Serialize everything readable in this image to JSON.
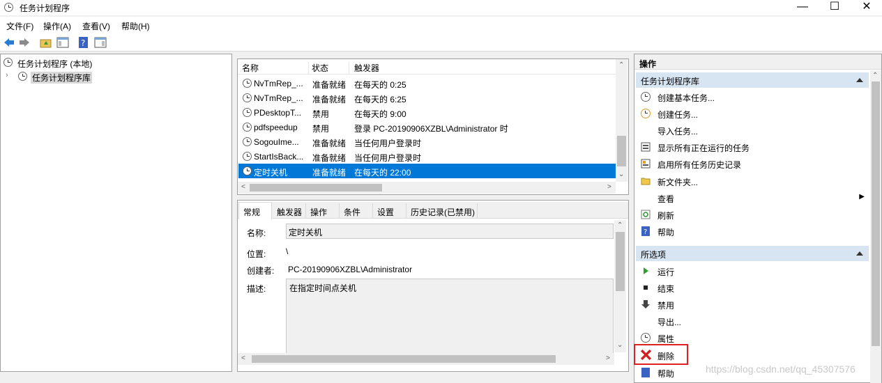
{
  "window": {
    "title": "任务计划程序"
  },
  "menu": [
    "文件(F)",
    "操作(A)",
    "查看(V)",
    "帮助(H)"
  ],
  "tree": {
    "root": "任务计划程序 (本地)",
    "child": "任务计划程序库"
  },
  "list": {
    "headers": [
      "名称",
      "状态",
      "触发器"
    ],
    "rows": [
      [
        "NvTmRep_...",
        "准备就绪",
        "在每天的 0:25"
      ],
      [
        "NvTmRep_...",
        "准备就绪",
        "在每天的 6:25"
      ],
      [
        "PDesktopT...",
        "禁用",
        "在每天的 9:00"
      ],
      [
        "pdfspeedup",
        "禁用",
        "登录 PC-20190906XZBL\\Administrator 时"
      ],
      [
        "SogouIme...",
        "准备就绪",
        "当任何用户登录时"
      ],
      [
        "StartIsBack...",
        "准备就绪",
        "当任何用户登录时"
      ],
      [
        "定时关机",
        "准备就绪",
        "在每天的 22:00"
      ]
    ]
  },
  "detail": {
    "tabs": [
      "常规",
      "触发器",
      "操作",
      "条件",
      "设置",
      "历史记录(已禁用)"
    ],
    "name_label": "名称:",
    "name_value": "定时关机",
    "location_label": "位置:",
    "location_value": "\\",
    "author_label": "创建者:",
    "author_value": "PC-20190906XZBL\\Administrator",
    "desc_label": "描述:",
    "desc_value": "在指定时间点关机"
  },
  "actions": {
    "title": "操作",
    "section1": "任务计划程序库",
    "items1": [
      "创建基本任务...",
      "创建任务...",
      "导入任务...",
      "显示所有正在运行的任务",
      "启用所有任务历史记录",
      "新文件夹...",
      "查看",
      "刷新",
      "帮助"
    ],
    "section2": "所选项",
    "items2": [
      "运行",
      "结束",
      "禁用",
      "导出...",
      "属性",
      "删除",
      "帮助"
    ]
  },
  "watermark": "https://blog.csdn.net/qq_45307576",
  "colors": {
    "selection": "#0078d7",
    "section_header": "#d7e4f2",
    "highlight_box": "#e02020"
  }
}
